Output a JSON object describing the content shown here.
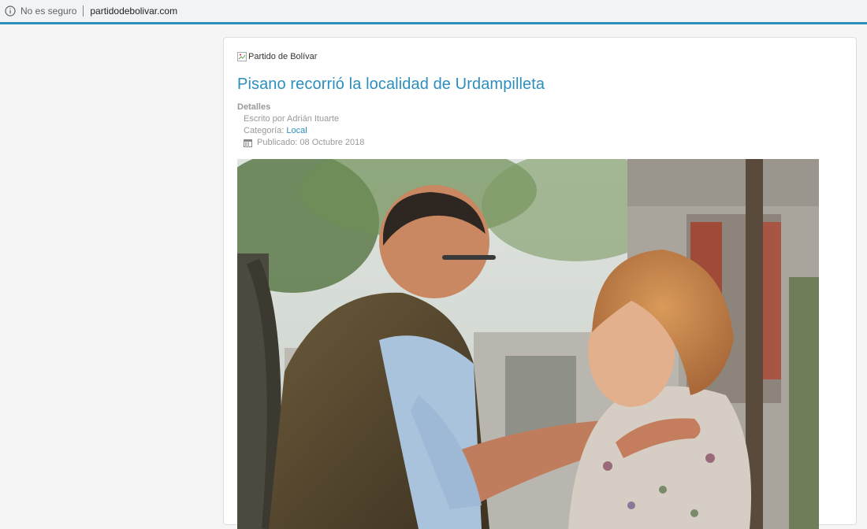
{
  "browser": {
    "security_label": "No es seguro",
    "url": "partidodebolivar.com",
    "accent_color": "#2a8fbd"
  },
  "article": {
    "logo_alt": "Partido de Bolívar",
    "title": "Pisano recorrió la localidad de Urdampilleta",
    "details_label": "Detalles",
    "author": "Escrito por Adrián Ituarte",
    "category_prefix": "Categoría: ",
    "category": "Local",
    "published": "Publicado: 08 Octubre 2018",
    "link_color": "#2a8fbd"
  },
  "icons": {
    "info": "info-circle-icon",
    "broken_image": "broken-image-icon",
    "calendar": "calendar-icon"
  }
}
